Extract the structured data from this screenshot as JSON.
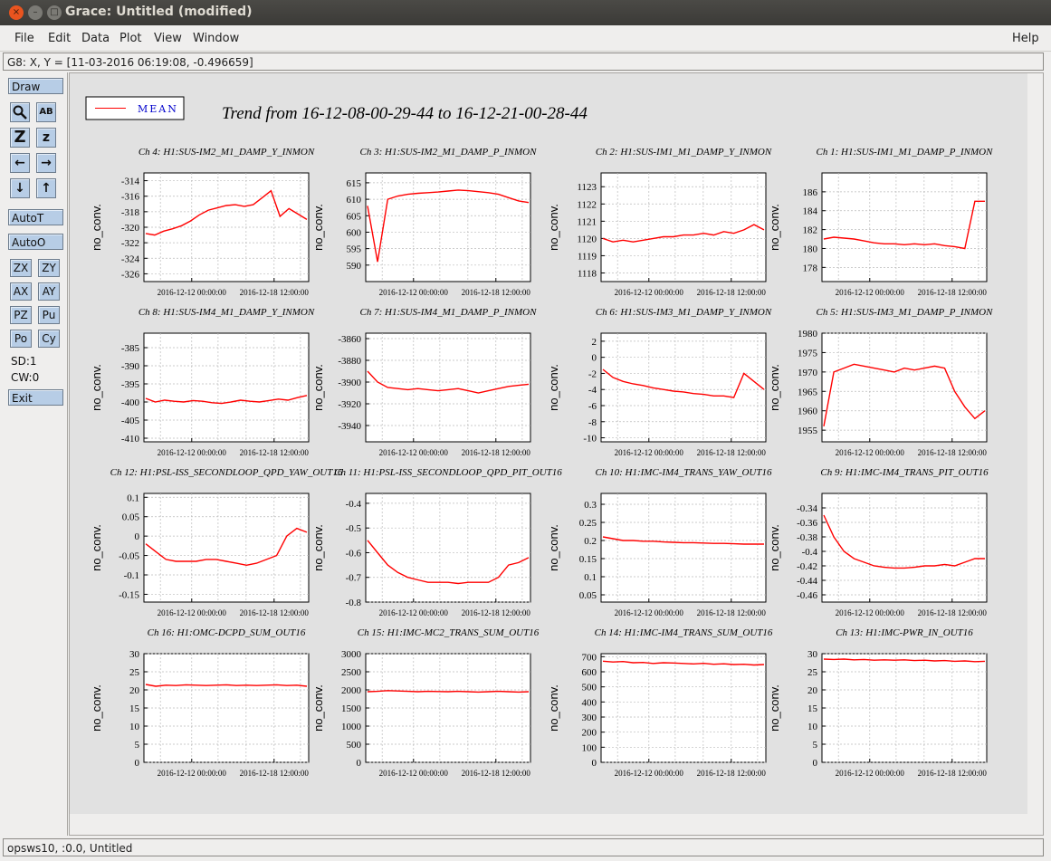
{
  "window": {
    "title": "Grace: Untitled (modified)",
    "close_glyph": "×",
    "min_glyph": "–",
    "max_glyph": "□"
  },
  "menu": {
    "file": "File",
    "edit": "Edit",
    "data": "Data",
    "plot": "Plot",
    "view": "View",
    "window": "Window",
    "help": "Help"
  },
  "locator": {
    "text": "G8: X, Y = [11-03-2016 06:19:08, -0.496659]"
  },
  "tools": {
    "draw": "Draw",
    "autot": "AutoT",
    "autoo": "AutoO",
    "zx": "ZX",
    "zy": "ZY",
    "ax": "AX",
    "ay": "AY",
    "pz": "PZ",
    "pu": "Pu",
    "po": "Po",
    "cy": "Cy",
    "sd": "SD:1",
    "cw": "CW:0",
    "exit": "Exit",
    "zoom_glyph": "Z",
    "shrink_glyph": "z",
    "left_glyph": "←",
    "right_glyph": "→",
    "down_glyph": "↓",
    "up_glyph": "↑",
    "text_glyph": "AB"
  },
  "status": {
    "text": "opsws10, :0.0, Untitled"
  },
  "canvas": {
    "title": "Trend from 16-12-08-00-29-44 to 16-12-21-00-28-44",
    "legend": "MEAN",
    "colors": {
      "series": "#ff0000",
      "text": "#000000",
      "legend_text": "#0000cc"
    }
  },
  "chart_data": [
    {
      "type": "line",
      "title": "Ch 4: H1:SUS-IM2_M1_DAMP_Y_INMON",
      "ylabel": "no_conv.",
      "xlabel": "",
      "x_ticks": [
        "2016-12-12 00:00:00",
        "2016-12-18 12:00:00"
      ],
      "ylim": [
        -327,
        -313
      ],
      "y_ticks": [
        -314,
        -316,
        -318,
        -320,
        -322,
        -324,
        -326
      ],
      "series": [
        {
          "name": "MEAN",
          "values": [
            -320.8,
            -321,
            -320.5,
            -320.2,
            -319.8,
            -319.2,
            -318.4,
            -317.8,
            -317.5,
            -317.2,
            -317.1,
            -317.3,
            -317.1,
            -316.2,
            -315.3,
            -318.6,
            -317.6,
            -318.3,
            -319
          ]
        }
      ],
      "grid": true
    },
    {
      "type": "line",
      "title": "Ch 8: H1:SUS-IM4_M1_DAMP_Y_INMON",
      "ylabel": "no_conv.",
      "xlabel": "",
      "x_ticks": [
        "2016-12-12 00:00:00",
        "2016-12-18 12:00:00"
      ],
      "ylim": [
        -411,
        -381
      ],
      "y_ticks": [
        -385,
        -390,
        -395,
        -400,
        -405,
        -410
      ],
      "series": [
        {
          "name": "MEAN",
          "values": [
            -399,
            -400,
            -399.5,
            -399.8,
            -400,
            -399.6,
            -399.8,
            -400.2,
            -400.4,
            -400,
            -399.5,
            -399.8,
            -400,
            -399.6,
            -399.2,
            -399.5,
            -398.8,
            -398.2
          ]
        }
      ],
      "grid": true
    },
    {
      "type": "line",
      "title": "Ch 12: H1:PSL-ISS_SECONDLOOP_QPD_YAW_OUT16",
      "ylabel": "no_conv.",
      "xlabel": "",
      "x_ticks": [
        "2016-12-12 00:00:00",
        "2016-12-18 12:00:00"
      ],
      "ylim": [
        -0.17,
        0.11
      ],
      "y_ticks": [
        0.1,
        0.05,
        0,
        -0.05,
        -0.1,
        -0.15
      ],
      "series": [
        {
          "name": "MEAN",
          "values": [
            -0.02,
            -0.04,
            -0.06,
            -0.065,
            -0.065,
            -0.065,
            -0.06,
            -0.06,
            -0.065,
            -0.07,
            -0.075,
            -0.07,
            -0.06,
            -0.05,
            0,
            0.02,
            0.01
          ]
        }
      ],
      "grid": true
    },
    {
      "type": "line",
      "title": "Ch 16: H1:OMC-DCPD_SUM_OUT16",
      "ylabel": "no_conv.",
      "xlabel": "",
      "x_ticks": [
        "2016-12-12 00:00:00",
        "2016-12-18 12:00:00"
      ],
      "ylim": [
        0,
        30
      ],
      "y_ticks": [
        30,
        25,
        20,
        15,
        10,
        5,
        0
      ],
      "series": [
        {
          "name": "MEAN",
          "values": [
            21.5,
            21,
            21.3,
            21.2,
            21.4,
            21.3,
            21.2,
            21.3,
            21.4,
            21.2,
            21.3,
            21.2,
            21.3,
            21.4,
            21.2,
            21.3,
            21
          ]
        }
      ],
      "grid": true
    },
    {
      "type": "line",
      "title": "Ch 3: H1:SUS-IM2_M1_DAMP_P_INMON",
      "ylabel": "no_conv.",
      "xlabel": "",
      "x_ticks": [
        "2016-12-12 00:00:00",
        "2016-12-18 12:00:00"
      ],
      "ylim": [
        585,
        618
      ],
      "y_ticks": [
        615,
        610,
        605,
        600,
        595,
        590
      ],
      "series": [
        {
          "name": "MEAN",
          "values": [
            608,
            591,
            610,
            611,
            611.5,
            611.8,
            612,
            612.2,
            612.5,
            612.8,
            612.6,
            612.3,
            612,
            611.5,
            610.5,
            609.5,
            609
          ]
        }
      ],
      "grid": true
    },
    {
      "type": "line",
      "title": "Ch 7: H1:SUS-IM4_M1_DAMP_P_INMON",
      "ylabel": "no_conv.",
      "xlabel": "",
      "x_ticks": [
        "2016-12-12 00:00:00",
        "2016-12-18 12:00:00"
      ],
      "ylim": [
        -3955,
        -3855
      ],
      "y_ticks": [
        -3860,
        -3880,
        -3900,
        -3920,
        -3940
      ],
      "series": [
        {
          "name": "MEAN",
          "values": [
            -3890,
            -3900,
            -3905,
            -3906,
            -3907,
            -3906,
            -3907,
            -3908,
            -3907,
            -3906,
            -3908,
            -3910,
            -3908,
            -3906,
            -3904,
            -3903,
            -3902
          ]
        }
      ],
      "grid": true
    },
    {
      "type": "line",
      "title": "Ch 11: H1:PSL-ISS_SECONDLOOP_QPD_PIT_OUT16",
      "ylabel": "no_conv.",
      "xlabel": "",
      "x_ticks": [
        "2016-12-12 00:00:00",
        "2016-12-18 12:00:00"
      ],
      "ylim": [
        -0.8,
        -0.36
      ],
      "y_ticks": [
        -0.4,
        -0.5,
        -0.6,
        -0.7,
        -0.8
      ],
      "series": [
        {
          "name": "MEAN",
          "values": [
            -0.55,
            -0.6,
            -0.65,
            -0.68,
            -0.7,
            -0.71,
            -0.72,
            -0.72,
            -0.72,
            -0.725,
            -0.72,
            -0.72,
            -0.72,
            -0.7,
            -0.65,
            -0.64,
            -0.62
          ]
        }
      ],
      "grid": true
    },
    {
      "type": "line",
      "title": "Ch 15: H1:IMC-MC2_TRANS_SUM_OUT16",
      "ylabel": "no_conv.",
      "xlabel": "",
      "x_ticks": [
        "2016-12-12 00:00:00",
        "2016-12-18 12:00:00"
      ],
      "ylim": [
        0,
        3000
      ],
      "y_ticks": [
        3000,
        2500,
        2000,
        1500,
        1000,
        500,
        0
      ],
      "series": [
        {
          "name": "MEAN",
          "values": [
            1950,
            1960,
            1980,
            1970,
            1960,
            1950,
            1960,
            1955,
            1950,
            1960,
            1950,
            1940,
            1950,
            1960,
            1950,
            1940,
            1950
          ]
        }
      ],
      "grid": true
    },
    {
      "type": "line",
      "title": "Ch 2: H1:SUS-IM1_M1_DAMP_Y_INMON",
      "ylabel": "no_conv.",
      "xlabel": "",
      "x_ticks": [
        "2016-12-12 00:00:00",
        "2016-12-18 12:00:00"
      ],
      "ylim": [
        1117.5,
        1123.8
      ],
      "y_ticks": [
        1123,
        1122,
        1121,
        1120,
        1119,
        1118
      ],
      "series": [
        {
          "name": "MEAN",
          "values": [
            1120,
            1119.8,
            1119.9,
            1119.8,
            1119.9,
            1120,
            1120.1,
            1120.1,
            1120.2,
            1120.2,
            1120.3,
            1120.2,
            1120.4,
            1120.3,
            1120.5,
            1120.8,
            1120.5
          ]
        }
      ],
      "grid": true
    },
    {
      "type": "line",
      "title": "Ch 6: H1:SUS-IM3_M1_DAMP_Y_INMON",
      "ylabel": "no_conv.",
      "xlabel": "",
      "x_ticks": [
        "2016-12-12 00:00:00",
        "2016-12-18 12:00:00"
      ],
      "ylim": [
        -10.5,
        3
      ],
      "y_ticks": [
        2,
        0,
        -2,
        -4,
        -6,
        -8,
        -10
      ],
      "series": [
        {
          "name": "MEAN",
          "values": [
            -1.5,
            -2.5,
            -3,
            -3.3,
            -3.5,
            -3.8,
            -4,
            -4.2,
            -4.3,
            -4.5,
            -4.6,
            -4.8,
            -4.8,
            -5,
            -2,
            -3,
            -4
          ]
        }
      ],
      "grid": true
    },
    {
      "type": "line",
      "title": "Ch 10: H1:IMC-IM4_TRANS_YAW_OUT16",
      "ylabel": "no_conv.",
      "xlabel": "",
      "x_ticks": [
        "2016-12-12 00:00:00",
        "2016-12-18 12:00:00"
      ],
      "ylim": [
        0.03,
        0.33
      ],
      "y_ticks": [
        0.3,
        0.25,
        0.2,
        0.15,
        0.1,
        0.05
      ],
      "series": [
        {
          "name": "MEAN",
          "values": [
            0.21,
            0.205,
            0.2,
            0.2,
            0.198,
            0.198,
            0.196,
            0.195,
            0.194,
            0.194,
            0.193,
            0.192,
            0.192,
            0.191,
            0.19,
            0.19,
            0.19
          ]
        }
      ],
      "grid": true
    },
    {
      "type": "line",
      "title": "Ch 14: H1:IMC-IM4_TRANS_SUM_OUT16",
      "ylabel": "no_conv.",
      "xlabel": "",
      "x_ticks": [
        "2016-12-12 00:00:00",
        "2016-12-18 12:00:00"
      ],
      "ylim": [
        0,
        720
      ],
      "y_ticks": [
        700,
        600,
        500,
        400,
        300,
        200,
        100,
        0
      ],
      "series": [
        {
          "name": "MEAN",
          "values": [
            670,
            665,
            668,
            660,
            662,
            655,
            660,
            658,
            655,
            652,
            656,
            650,
            653,
            648,
            650,
            645,
            648
          ]
        }
      ],
      "grid": true
    },
    {
      "type": "line",
      "title": "Ch 1: H1:SUS-IM1_M1_DAMP_P_INMON",
      "ylabel": "no_conv.",
      "xlabel": "",
      "x_ticks": [
        "2016-12-12 00:00:00",
        "2016-12-18 12:00:00"
      ],
      "ylim": [
        176.5,
        188
      ],
      "y_ticks": [
        186,
        184,
        182,
        180,
        178
      ],
      "series": [
        {
          "name": "MEAN",
          "values": [
            181,
            181.2,
            181.1,
            181,
            180.8,
            180.6,
            180.5,
            180.5,
            180.4,
            180.5,
            180.4,
            180.5,
            180.3,
            180.2,
            180,
            185,
            185
          ]
        }
      ],
      "grid": true
    },
    {
      "type": "line",
      "title": "Ch 5: H1:SUS-IM3_M1_DAMP_P_INMON",
      "ylabel": "no_conv.",
      "xlabel": "",
      "x_ticks": [
        "2016-12-12 00:00:00",
        "2016-12-18 12:00:00"
      ],
      "ylim": [
        1952,
        1980
      ],
      "y_ticks": [
        1980,
        1975,
        1970,
        1965,
        1960,
        1955
      ],
      "series": [
        {
          "name": "MEAN",
          "values": [
            1956,
            1970,
            1971,
            1972,
            1971.5,
            1971,
            1970.5,
            1970,
            1971,
            1970.5,
            1971,
            1971.5,
            1971,
            1965,
            1961,
            1958,
            1960
          ]
        }
      ],
      "grid": true
    },
    {
      "type": "line",
      "title": "Ch 9: H1:IMC-IM4_TRANS_PIT_OUT16",
      "ylabel": "no_conv.",
      "xlabel": "",
      "x_ticks": [
        "2016-12-12 00:00:00",
        "2016-12-18 12:00:00"
      ],
      "ylim": [
        -0.47,
        -0.32
      ],
      "y_ticks": [
        -0.34,
        -0.36,
        -0.38,
        -0.4,
        -0.42,
        -0.44,
        -0.46
      ],
      "series": [
        {
          "name": "MEAN",
          "values": [
            -0.35,
            -0.38,
            -0.4,
            -0.41,
            -0.415,
            -0.42,
            -0.422,
            -0.423,
            -0.423,
            -0.422,
            -0.42,
            -0.42,
            -0.418,
            -0.42,
            -0.415,
            -0.41,
            -0.41
          ]
        }
      ],
      "grid": true
    },
    {
      "type": "line",
      "title": "Ch 13: H1:IMC-PWR_IN_OUT16",
      "ylabel": "no_conv.",
      "xlabel": "",
      "x_ticks": [
        "2016-12-12 00:00:00",
        "2016-12-18 12:00:00"
      ],
      "ylim": [
        0,
        30
      ],
      "y_ticks": [
        30,
        25,
        20,
        15,
        10,
        5,
        0
      ],
      "series": [
        {
          "name": "MEAN",
          "values": [
            28.5,
            28.4,
            28.5,
            28.3,
            28.4,
            28.2,
            28.3,
            28.2,
            28.3,
            28.1,
            28.2,
            28,
            28.1,
            27.9,
            28,
            27.8,
            27.9
          ]
        }
      ],
      "grid": true
    }
  ]
}
